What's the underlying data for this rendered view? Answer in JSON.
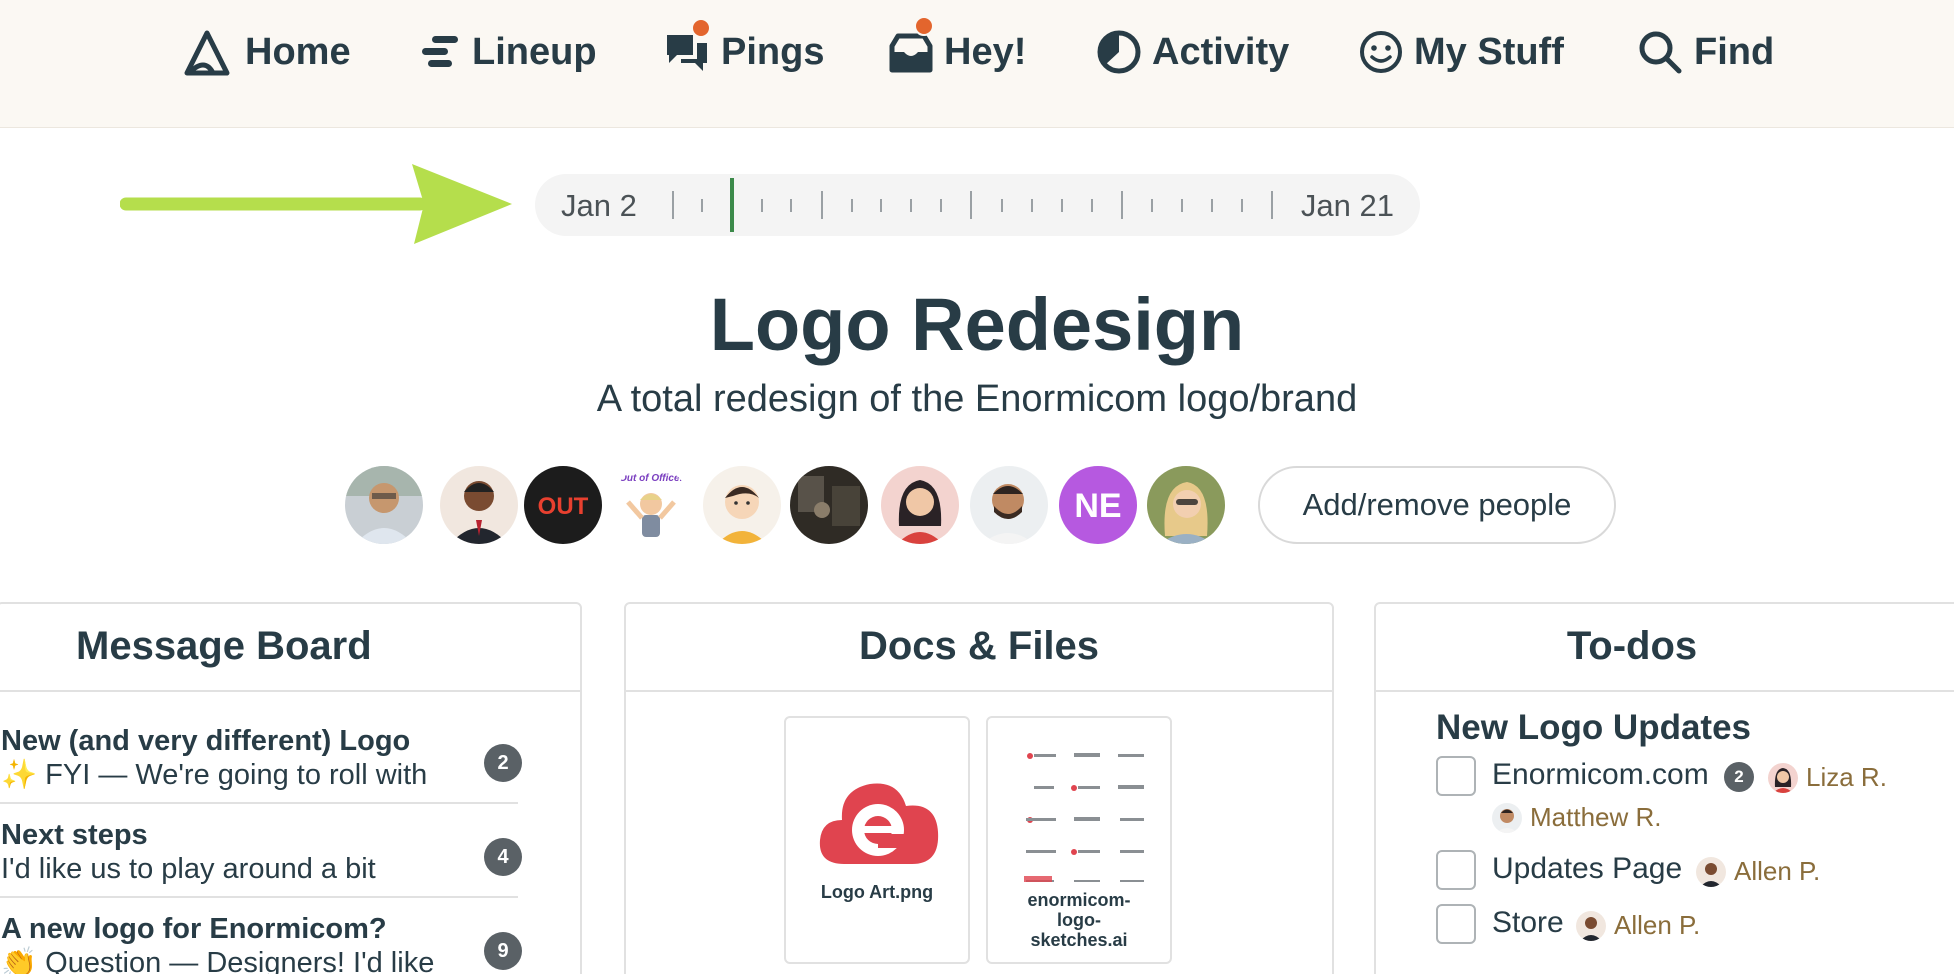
{
  "nav": {
    "items": [
      {
        "label": "Home",
        "icon": "basecamp-icon"
      },
      {
        "label": "Lineup",
        "icon": "lineup-icon"
      },
      {
        "label": "Pings",
        "icon": "pings-icon",
        "unread": true
      },
      {
        "label": "Hey!",
        "icon": "hey-inbox-icon",
        "unread": true
      },
      {
        "label": "Activity",
        "icon": "activity-pie-icon"
      },
      {
        "label": "My Stuff",
        "icon": "smiley-icon"
      },
      {
        "label": "Find",
        "icon": "search-icon"
      }
    ],
    "badge_color": "#e3652d"
  },
  "timeline": {
    "start_label": "Jan 2",
    "end_label": "Jan 21",
    "current_color": "#3c8a4a"
  },
  "annotation": {
    "arrow_color": "#b5de4c"
  },
  "project": {
    "title": "Logo Redesign",
    "description": "A total redesign of the Enormicom logo/brand"
  },
  "people": {
    "avatars": [
      {
        "kind": "photo",
        "name": "man-glasses"
      },
      {
        "kind": "photo",
        "name": "man-suit"
      },
      {
        "kind": "text",
        "text": "OUT",
        "bg": "#1c1c1c",
        "fg": "#e8402f"
      },
      {
        "kind": "sticker",
        "text": "Out of Office!"
      },
      {
        "kind": "photo",
        "name": "cartoon-boy"
      },
      {
        "kind": "photo",
        "name": "dark-photo"
      },
      {
        "kind": "photo",
        "name": "illustrated-woman"
      },
      {
        "kind": "photo",
        "name": "bearded-man"
      },
      {
        "kind": "text",
        "text": "NE",
        "bg": "#b659e0",
        "fg": "#ffffff"
      },
      {
        "kind": "photo",
        "name": "blonde-woman"
      }
    ],
    "add_label": "Add/remove people"
  },
  "message_board": {
    "title": "Message Board",
    "messages": [
      {
        "title": "New (and very different) Logo",
        "emoji": "✨",
        "excerpt": " FYI — We're going to roll with",
        "count": "2"
      },
      {
        "title": "Next steps",
        "emoji": "",
        "excerpt": "I'd like us to play around a bit",
        "count": "4"
      },
      {
        "title": "A new logo for Enormicom?",
        "emoji": "👏",
        "excerpt": " Question — Designers! I'd like",
        "count": "9"
      }
    ]
  },
  "docs": {
    "title": "Docs & Files",
    "files": [
      {
        "name": "Logo Art.png"
      },
      {
        "name_lines": [
          "enormicom-",
          "logo-",
          "sketches.ai"
        ]
      }
    ]
  },
  "todos": {
    "title": "To-dos",
    "list_title": "New Logo Updates",
    "items": [
      {
        "text": "Enormicom.com",
        "count": "2",
        "assignees": [
          "Liza R.",
          "Matthew R."
        ]
      },
      {
        "text": "Updates Page",
        "assignees": [
          "Allen P."
        ]
      },
      {
        "text": "Store",
        "assignees": [
          "Allen P."
        ]
      }
    ]
  }
}
